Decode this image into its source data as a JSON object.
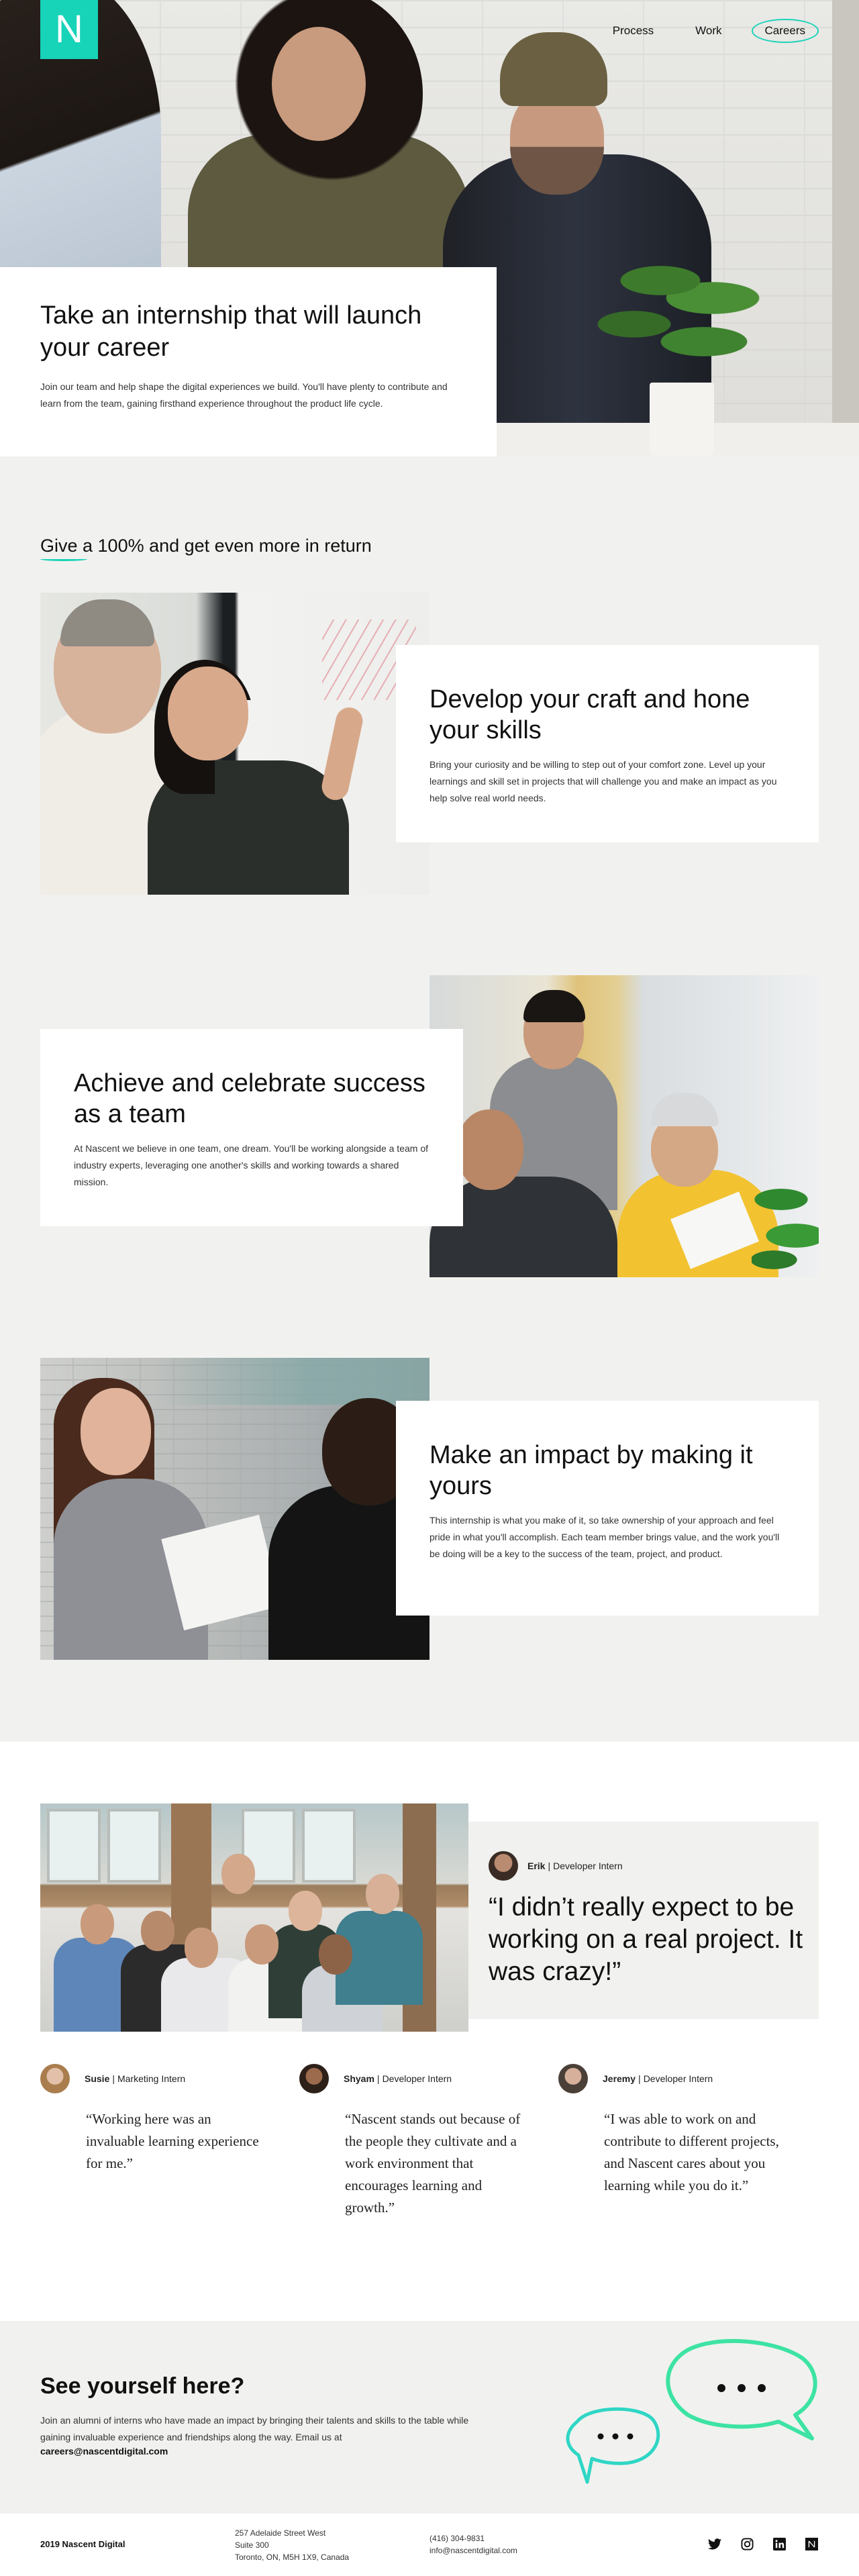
{
  "header": {
    "logo_letter": "N",
    "nav": [
      {
        "label": "Process",
        "active": false
      },
      {
        "label": "Work",
        "active": false
      },
      {
        "label": "Careers",
        "active": true
      }
    ],
    "accent": "#17d3b8"
  },
  "hero": {
    "title": "Take an internship that will launch your career",
    "body": "Join our team and help shape the digital experiences we build. You'll have plenty to contribute and learn from the team, gaining firsthand experience throughout the product life cycle."
  },
  "give": {
    "title": "Give a 100% and get even more in return",
    "features": [
      {
        "title": "Develop your craft and hone your skills",
        "body": "Bring your curiosity and be willing to step out of your comfort zone. Level up your learnings and skill set in projects that will challenge you and make an impact as you help solve real world needs."
      },
      {
        "title": "Achieve and celebrate success as a team",
        "body": "At Nascent we believe in one team, one dream. You'll be working alongside a team of industry experts, leveraging one another's skills and working towards a shared mission."
      },
      {
        "title": "Make an impact by making it yours",
        "body": "This internship is what you make of it, so take ownership of your approach and feel pride in what you'll accomplish. Each team member brings value, and the work you'll be doing will be a key to the success of the team, project, and product."
      }
    ]
  },
  "testimonials": {
    "featured": {
      "name": "Erik",
      "role": "Developer Intern",
      "quote": "“I didn’t really expect to be working on a real project. It was crazy!”"
    },
    "others": [
      {
        "name": "Susie",
        "role": "Marketing Intern",
        "quote": "“Working here was an invaluable learning experience for me.”"
      },
      {
        "name": "Shyam",
        "role": "Developer Intern",
        "quote": "“Nascent stands out because of the people they cultivate and a work environment that encourages learning and growth.”"
      },
      {
        "name": "Jeremy",
        "role": "Developer Intern",
        "quote": "“I was able to work on and contribute to different projects, and Nascent cares about you learning while you do it.”"
      }
    ]
  },
  "cta": {
    "title": "See yourself here?",
    "body": "Join an alumni of interns who have made an impact by bringing their talents and skills to the table while gaining invaluable experience and friendships along the way. Email us at",
    "email": "careers@nascentdigital.com"
  },
  "footer": {
    "copyright": "2019 Nascent Digital",
    "address_line1": "257 Adelaide Street West",
    "address_line2": "Suite 300",
    "address_line3": "Toronto, ON, M5H 1X9, Canada",
    "phone": "(416) 304-9831",
    "email": "info@nascentdigital.com",
    "social_icons": [
      "twitter-icon",
      "instagram-icon",
      "linkedin-icon",
      "nascent-icon"
    ]
  }
}
